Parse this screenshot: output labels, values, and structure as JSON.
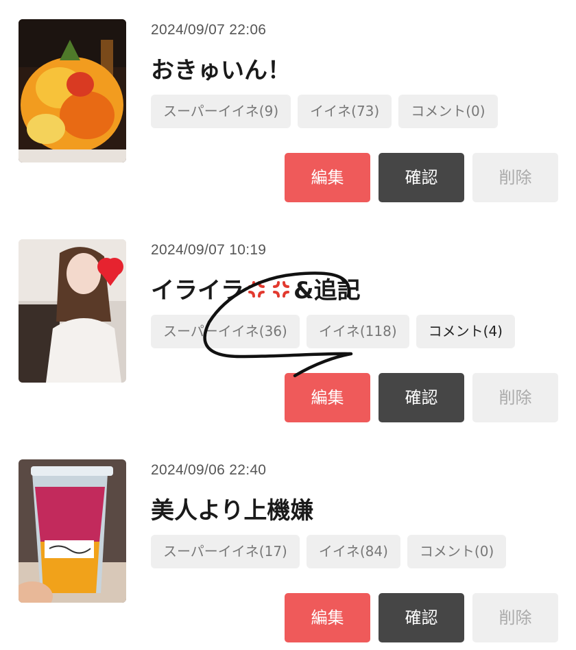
{
  "posts": [
    {
      "date": "2024/09/07 22:06",
      "title": "おきゅいん！",
      "super_like": "スーパーイイネ(9)",
      "like": "イイネ(73)",
      "comment": "コメント(0)",
      "thumb_icon": "fruit-platter-photo"
    },
    {
      "date": "2024/09/07 10:19",
      "title_a": "イライラ",
      "title_b": "&追記",
      "title_emoji": "anger-symbol-emoji",
      "super_like": "スーパーイイネ(36)",
      "like": "イイネ(118)",
      "comment": "コメント(4)",
      "thumb_icon": "portrait-photo"
    },
    {
      "date": "2024/09/06 22:40",
      "title": "美人より上機嫌",
      "super_like": "スーパーイイネ(17)",
      "like": "イイネ(84)",
      "comment": "コメント(0)",
      "thumb_icon": "drink-cup-photo"
    }
  ],
  "buttons": {
    "edit": "編集",
    "confirm": "確認",
    "delete": "削除"
  },
  "colors": {
    "edit": "#ef5a5a",
    "confirm": "#464646",
    "delete": "#efefef",
    "chip": "#efefef"
  }
}
